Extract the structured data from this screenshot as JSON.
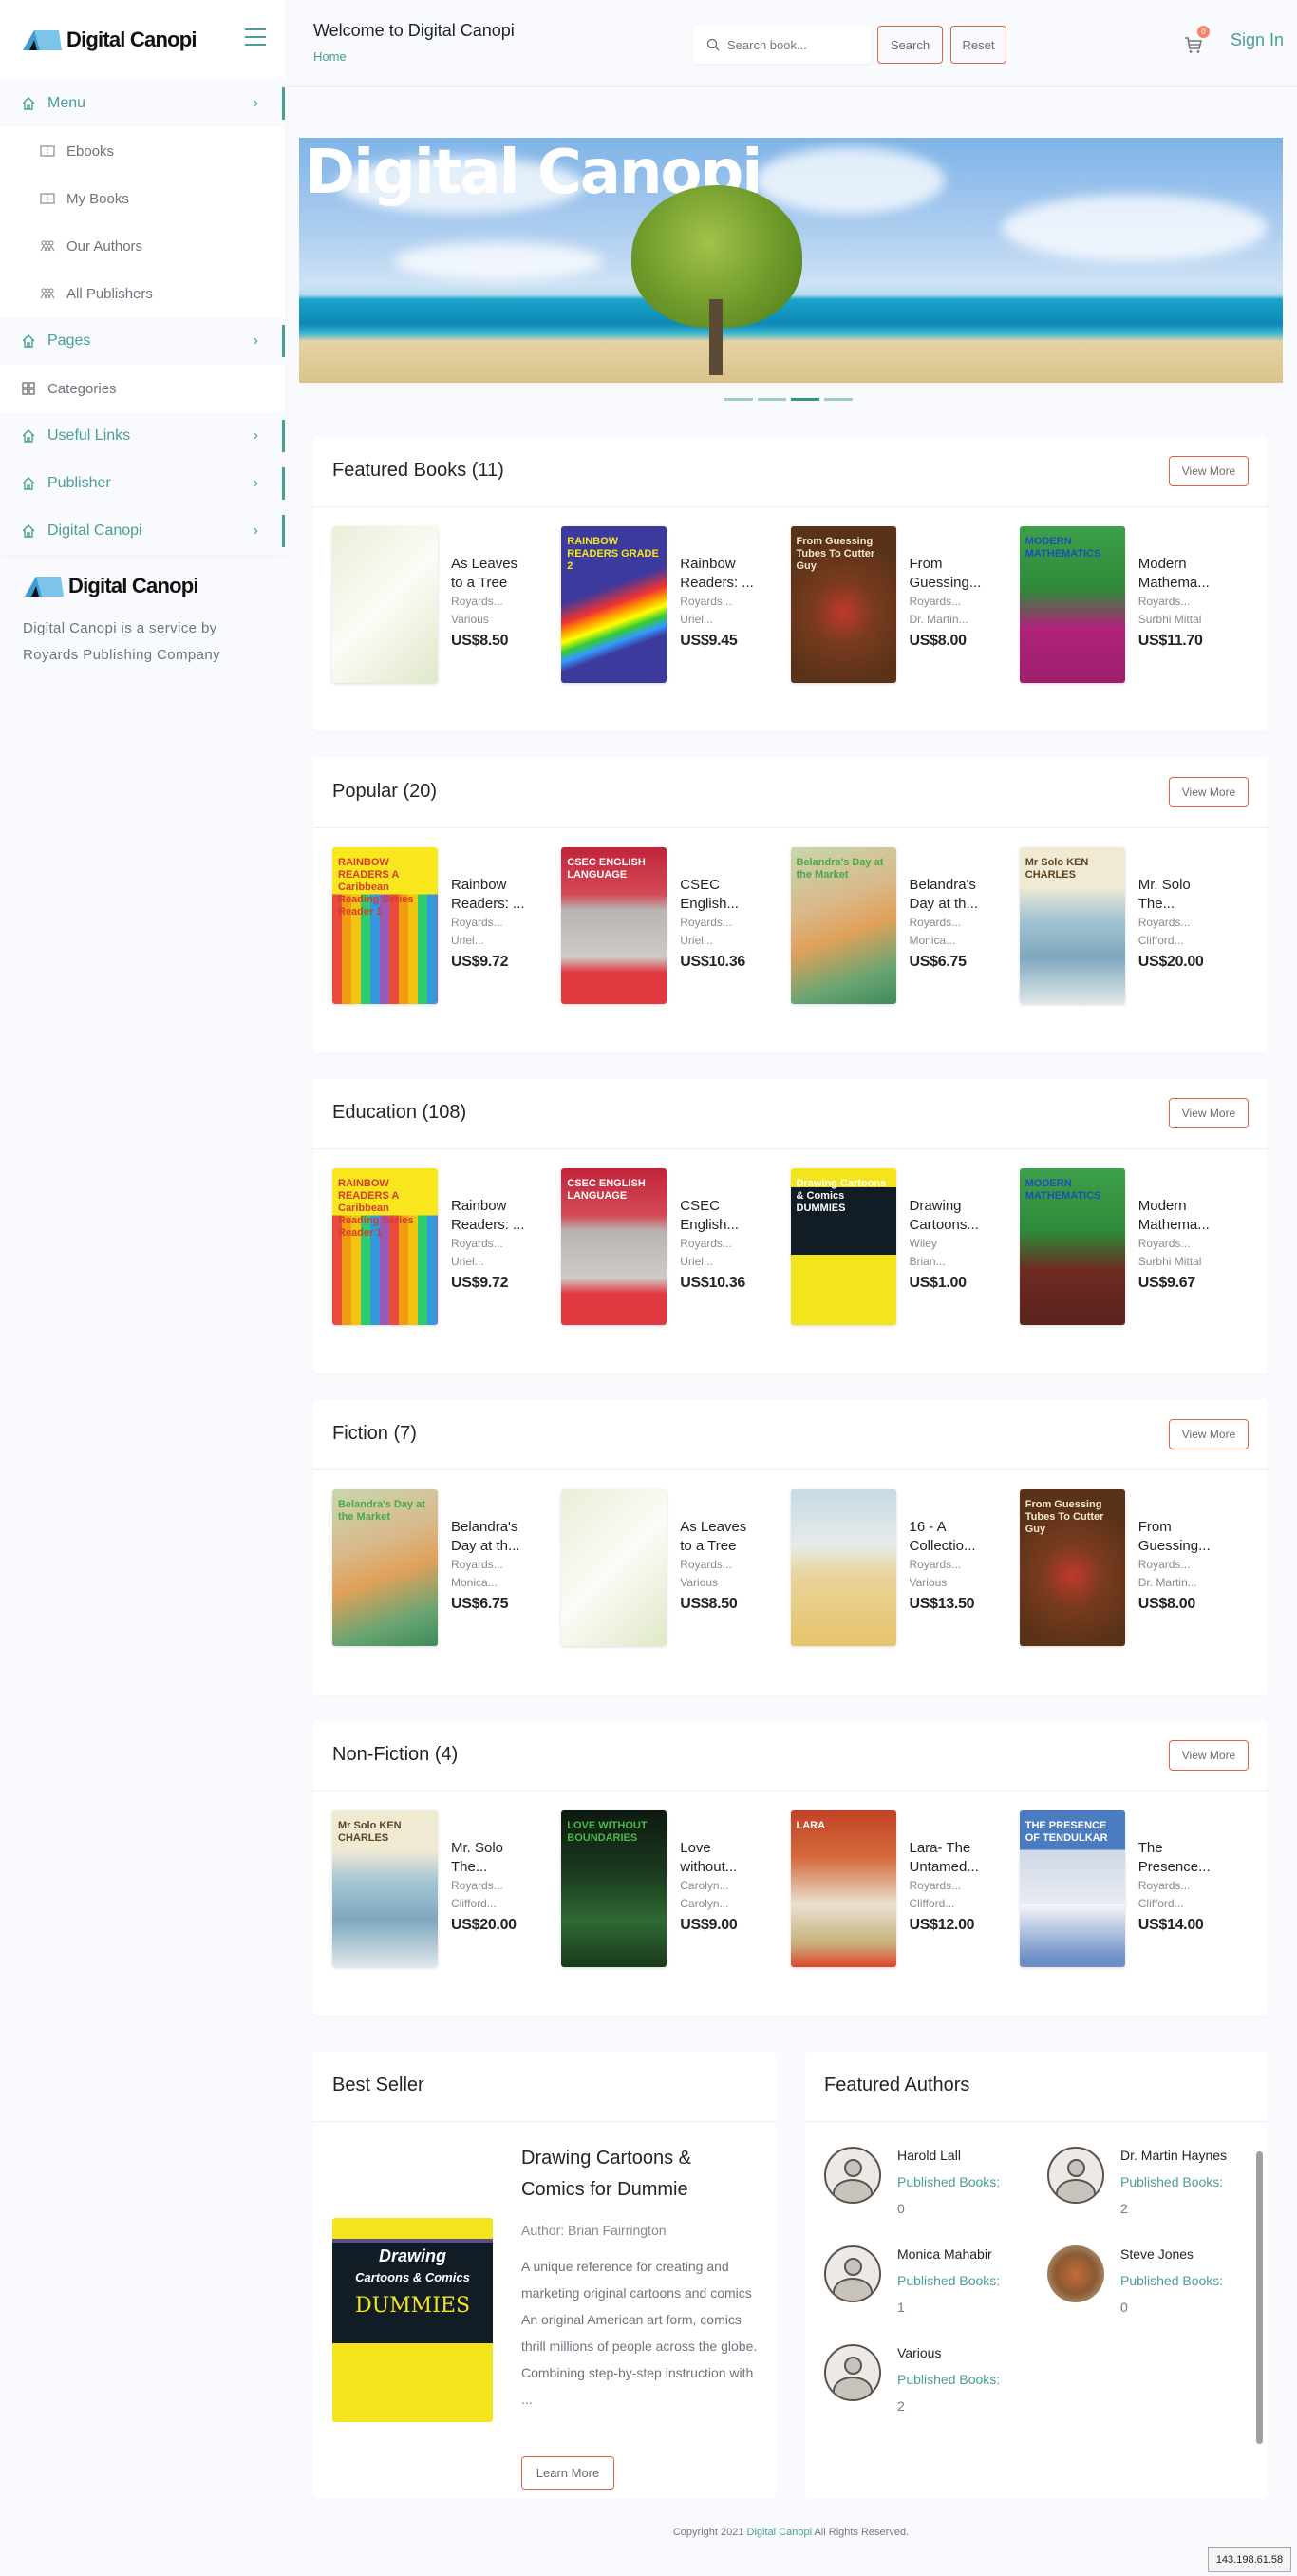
{
  "app": {
    "brand": "Digital Canopi",
    "accent_color": "#4a9e97",
    "button_border_color": "#e0653a"
  },
  "sidebar": {
    "logo_text": "Digital Canopi",
    "menu_icon": "hamburger-icon",
    "items": [
      {
        "label": "Menu",
        "type": "group",
        "icon": "home-icon"
      },
      {
        "label": "Ebooks",
        "type": "sub",
        "icon": "book-open-icon"
      },
      {
        "label": "My Books",
        "type": "sub",
        "icon": "book-open-icon"
      },
      {
        "label": "Our Authors",
        "type": "sub",
        "icon": "users-icon"
      },
      {
        "label": "All Publishers",
        "type": "sub",
        "icon": "users-icon"
      },
      {
        "label": "Pages",
        "type": "group",
        "icon": "home-icon"
      },
      {
        "label": "Categories",
        "type": "plain",
        "icon": "grid-icon"
      },
      {
        "label": "Useful Links",
        "type": "group",
        "icon": "home-icon"
      },
      {
        "label": "Publisher",
        "type": "group",
        "icon": "home-icon"
      },
      {
        "label": "Digital Canopi",
        "type": "group",
        "icon": "home-icon"
      }
    ],
    "footer_logo_text": "Digital Canopi",
    "footer_text": "Digital Canopi is a service by Royards Publishing Company"
  },
  "header": {
    "title": "Welcome to Digital Canopi",
    "breadcrumb": "Home",
    "search_placeholder": "Search book...",
    "search_value": "",
    "search_button": "Search",
    "reset_button": "Reset",
    "cart_count": "0",
    "signin": "Sign In"
  },
  "hero": {
    "title": "Digital Canopi",
    "slide_count": 4,
    "active_slide": 3
  },
  "sections": [
    {
      "title": "Featured Books (11)",
      "view_more": "View More",
      "books": [
        {
          "title": "As Leaves to a Tree",
          "title_display": "As Leaves to a Tree",
          "publisher": "Royards...",
          "author": "Various",
          "price": "US$8.50",
          "cover": "leaves",
          "cover_text": ""
        },
        {
          "title": "Rainbow Readers: ...",
          "title_display": "Rainbow Readers: ...",
          "publisher": "Royards...",
          "author": "Uriel...",
          "price": "US$9.45",
          "cover": "rainbow2",
          "cover_text": "RAINBOW READERS GRADE 2"
        },
        {
          "title": "From Guessing...",
          "title_display": "From Guessing...",
          "publisher": "Royards...",
          "author": "Dr. Martin...",
          "price": "US$8.00",
          "cover": "guessing",
          "cover_text": "From Guessing Tubes To Cutter Guy"
        },
        {
          "title": "Modern Mathema...",
          "title_display": "Modern Mathema...",
          "publisher": "Royards...",
          "author": "Surbhi Mittal",
          "price": "US$11.70",
          "cover": "math4",
          "cover_text": "MODERN MATHEMATICS"
        }
      ]
    },
    {
      "title": "Popular (20)",
      "view_more": "View More",
      "books": [
        {
          "title_display": "Rainbow Readers: ...",
          "publisher": "Royards...",
          "author": "Uriel...",
          "price": "US$9.72",
          "cover": "rainbow1",
          "cover_text": "RAINBOW READERS A Caribbean Reading Series Reader 1"
        },
        {
          "title_display": "CSEC English...",
          "publisher": "Royards...",
          "author": "Uriel...",
          "price": "US$10.36",
          "cover": "csec",
          "cover_text": "CSEC ENGLISH LANGUAGE"
        },
        {
          "title_display": "Belandra's Day at th...",
          "publisher": "Royards...",
          "author": "Monica...",
          "price": "US$6.75",
          "cover": "belandra",
          "cover_text": "Belandra's Day at the Market"
        },
        {
          "title_display": "Mr. Solo The...",
          "publisher": "Royards...",
          "author": "Clifford...",
          "price": "US$20.00",
          "cover": "solo",
          "cover_text": "Mr Solo KEN CHARLES"
        }
      ]
    },
    {
      "title": "Education (108)",
      "view_more": "View More",
      "books": [
        {
          "title_display": "Rainbow Readers: ...",
          "publisher": "Royards...",
          "author": "Uriel...",
          "price": "US$9.72",
          "cover": "rainbow1",
          "cover_text": "RAINBOW READERS A Caribbean Reading Series Reader 1"
        },
        {
          "title_display": "CSEC English...",
          "publisher": "Royards...",
          "author": "Uriel...",
          "price": "US$10.36",
          "cover": "csec",
          "cover_text": "CSEC ENGLISH LANGUAGE"
        },
        {
          "title_display": "Drawing Cartoons...",
          "publisher": "Wiley",
          "author": "Brian...",
          "price": "US$1.00",
          "cover": "dummies",
          "cover_text": "Drawing Cartoons & Comics DUMMIES"
        },
        {
          "title_display": "Modern Mathema...",
          "publisher": "Royards...",
          "author": "Surbhi Mittal",
          "price": "US$9.67",
          "cover": "math1",
          "cover_text": "MODERN MATHEMATICS"
        }
      ]
    },
    {
      "title": "Fiction (7)",
      "view_more": "View More",
      "books": [
        {
          "title_display": "Belandra's Day at th...",
          "publisher": "Royards...",
          "author": "Monica...",
          "price": "US$6.75",
          "cover": "belandra",
          "cover_text": "Belandra's Day at the Market"
        },
        {
          "title_display": "As Leaves to a Tree",
          "publisher": "Royards...",
          "author": "Various",
          "price": "US$8.50",
          "cover": "leaves",
          "cover_text": ""
        },
        {
          "title_display": "16 - A Collectio...",
          "publisher": "Royards...",
          "author": "Various",
          "price": "US$13.50",
          "cover": "sixteen",
          "cover_text": ""
        },
        {
          "title_display": "From Guessing...",
          "publisher": "Royards...",
          "author": "Dr. Martin...",
          "price": "US$8.00",
          "cover": "guessing",
          "cover_text": "From Guessing Tubes To Cutter Guy"
        }
      ]
    },
    {
      "title": "Non-Fiction (4)",
      "view_more": "View More",
      "books": [
        {
          "title_display": "Mr. Solo The...",
          "publisher": "Royards...",
          "author": "Clifford...",
          "price": "US$20.00",
          "cover": "solo",
          "cover_text": "Mr Solo KEN CHARLES"
        },
        {
          "title_display": "Love without...",
          "publisher": "Carolyn...",
          "author": "Carolyn...",
          "price": "US$9.00",
          "cover": "love",
          "cover_text": "LOVE WITHOUT BOUNDARIES"
        },
        {
          "title_display": "Lara- The Untamed...",
          "publisher": "Royards...",
          "author": "Clifford...",
          "price": "US$12.00",
          "cover": "lara",
          "cover_text": "LARA"
        },
        {
          "title_display": "The Presence...",
          "publisher": "Royards...",
          "author": "Clifford...",
          "price": "US$14.00",
          "cover": "tendulkar",
          "cover_text": "THE PRESENCE OF TENDULKAR"
        }
      ]
    }
  ],
  "best_seller": {
    "heading": "Best Seller",
    "title": "Drawing Cartoons & Comics for Dummie",
    "author": "Author: Brian Fairrington",
    "description": "A unique reference for creating and marketing original cartoons and comics An original American art form, comics thrill millions of people across the globe. Combining step-by-step instruction with ...",
    "cover_line1": "Drawing",
    "cover_line2": "Cartoons & Comics",
    "cover_line3": "DUMMIES",
    "button": "Learn More"
  },
  "featured_authors": {
    "heading": "Featured Authors",
    "label": "Published Books:",
    "authors": [
      {
        "name": "Harold Lall",
        "count": "0",
        "photo": false
      },
      {
        "name": "Dr. Martin Haynes",
        "count": "2",
        "photo": false
      },
      {
        "name": "Monica Mahabir",
        "count": "1",
        "photo": false
      },
      {
        "name": "Steve Jones",
        "count": "0",
        "photo": true
      },
      {
        "name": "Various",
        "count": "2",
        "photo": false
      }
    ]
  },
  "footer": {
    "prefix": "Copyright 2021 ",
    "brand": "Digital Canopi",
    "suffix": " All Rights Reserved.",
    "ip": "143.198.61.58"
  }
}
